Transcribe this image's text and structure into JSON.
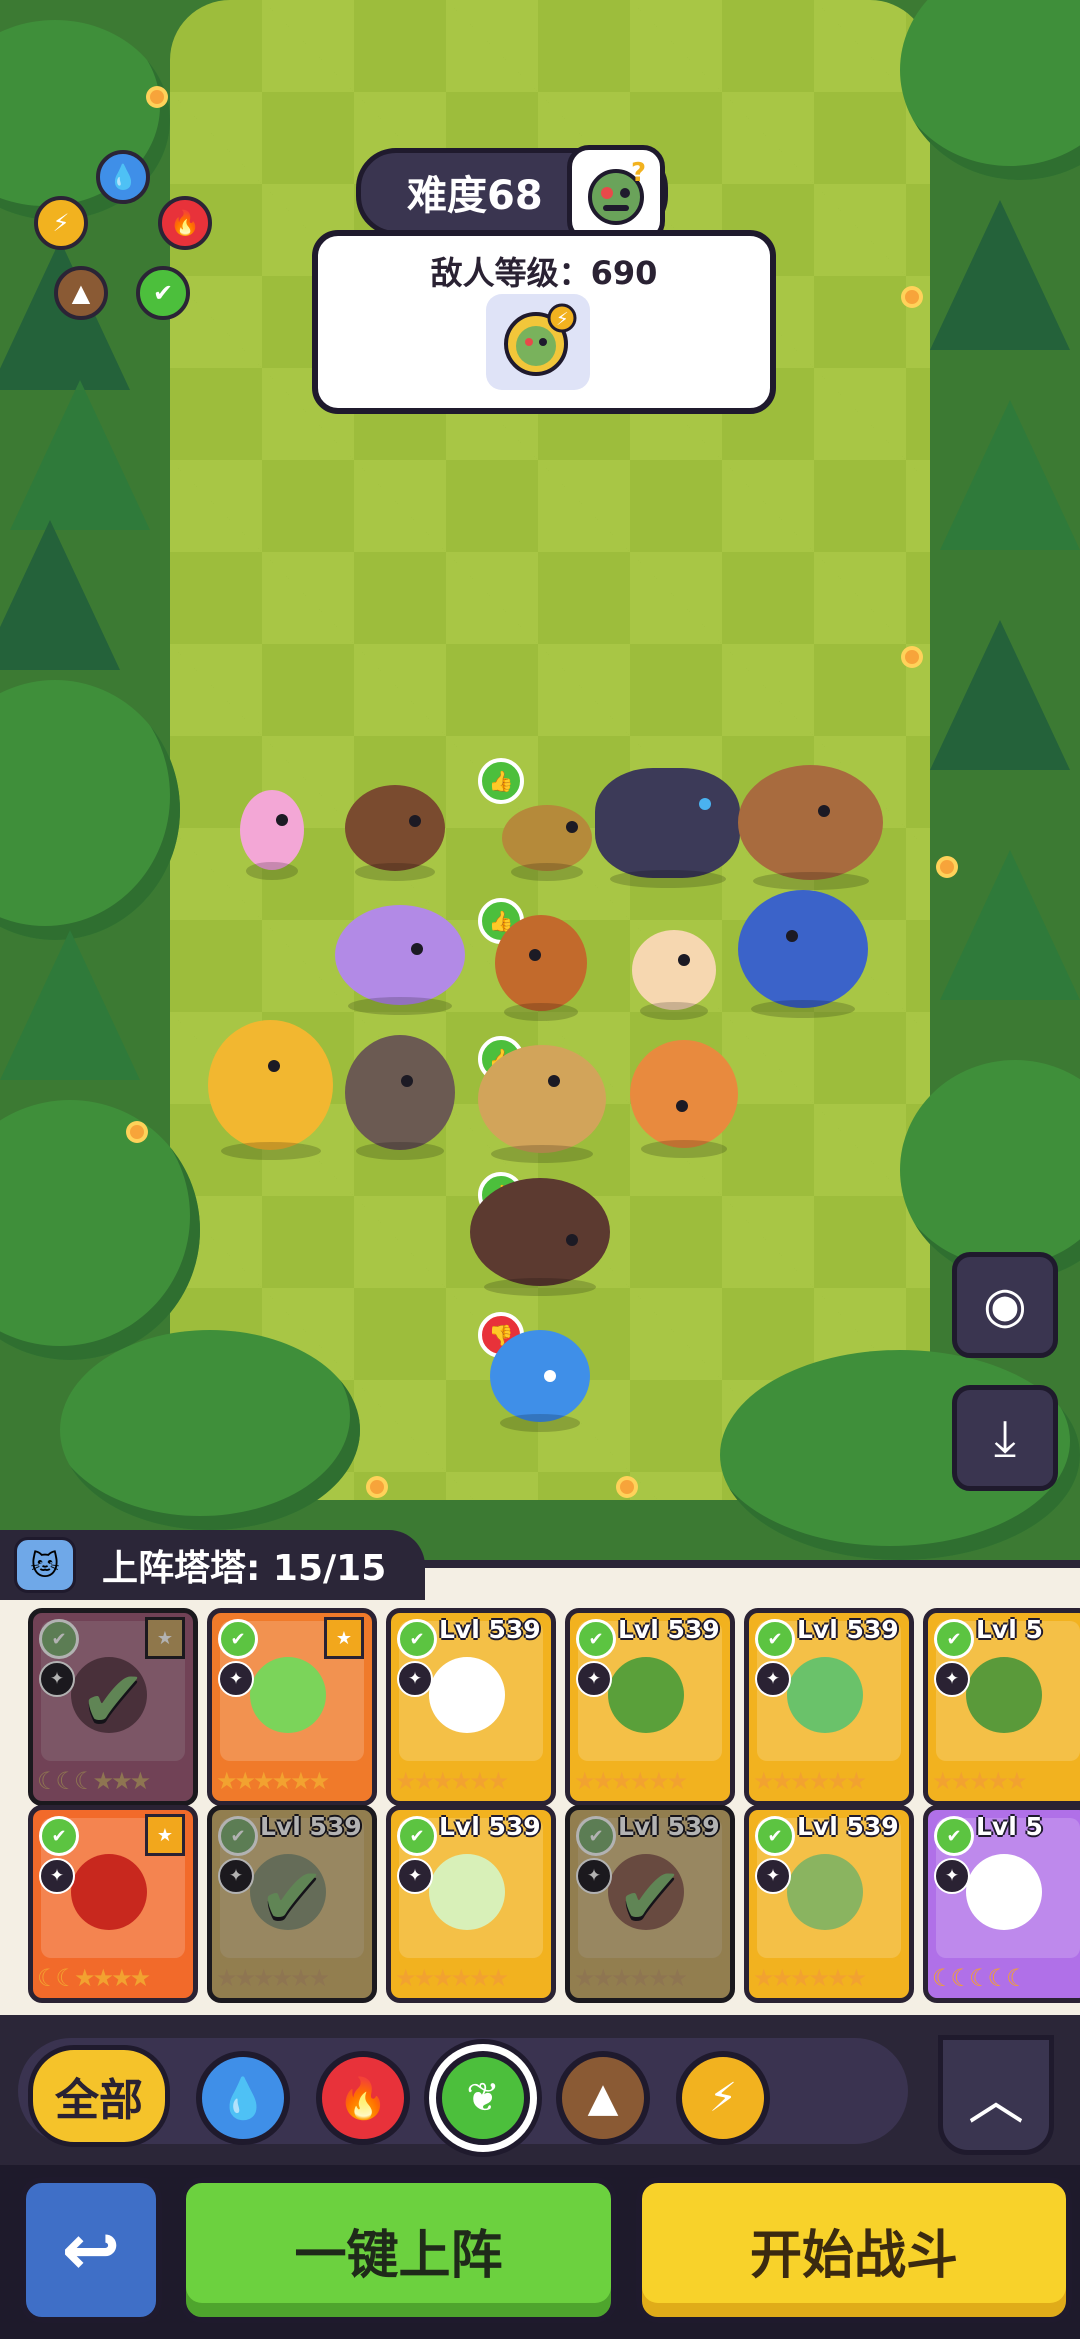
{
  "battle": {
    "difficulty_label": "难度68",
    "enemy_level_label": "敌人等级：690"
  },
  "deck": {
    "count_label": "上阵塔塔: 15/15",
    "cards": [
      {
        "level": "",
        "element": "grass",
        "in_lineup": true,
        "favorite": true,
        "stars": "☾☾☾★★★"
      },
      {
        "level": "",
        "element": "grass",
        "in_lineup": false,
        "favorite": true,
        "stars": "★★★★★★"
      },
      {
        "level": "Lvl 539",
        "element": "grass",
        "in_lineup": false,
        "favorite": false,
        "stars": "★★★★★★"
      },
      {
        "level": "Lvl 539",
        "element": "grass",
        "in_lineup": false,
        "favorite": false,
        "stars": "★★★★★★"
      },
      {
        "level": "Lvl 539",
        "element": "grass",
        "in_lineup": false,
        "favorite": false,
        "stars": "★★★★★★"
      },
      {
        "level": "Lvl 5",
        "element": "grass",
        "in_lineup": false,
        "favorite": false,
        "stars": "★★★★★"
      },
      {
        "level": "",
        "element": "grass",
        "in_lineup": false,
        "favorite": true,
        "stars": "☾☾★★★★"
      },
      {
        "level": "Lvl 539",
        "element": "grass",
        "in_lineup": true,
        "favorite": false,
        "stars": "★★★★★★"
      },
      {
        "level": "Lvl 539",
        "element": "grass",
        "in_lineup": false,
        "favorite": false,
        "stars": "★★★★★★"
      },
      {
        "level": "Lvl 539",
        "element": "grass",
        "in_lineup": true,
        "favorite": false,
        "stars": "★★★★★★"
      },
      {
        "level": "Lvl 539",
        "element": "grass",
        "in_lineup": false,
        "favorite": false,
        "stars": "★★★★★★"
      },
      {
        "level": "Lvl 5",
        "element": "grass",
        "in_lineup": false,
        "favorite": false,
        "stars": "☾☾☾☾☾"
      }
    ]
  },
  "filters": {
    "all_label": "全部",
    "elements": [
      "water",
      "fire",
      "grass",
      "earth",
      "lightning"
    ],
    "selected": "grass"
  },
  "actions": {
    "auto_deploy_label": "一键上阵",
    "start_battle_label": "开始战斗"
  },
  "colors": {
    "water": "#3f8fe8",
    "fire": "#e8323a",
    "grass": "#4cbf3c",
    "earth": "#8a5a34",
    "lightning": "#f2b21f"
  }
}
